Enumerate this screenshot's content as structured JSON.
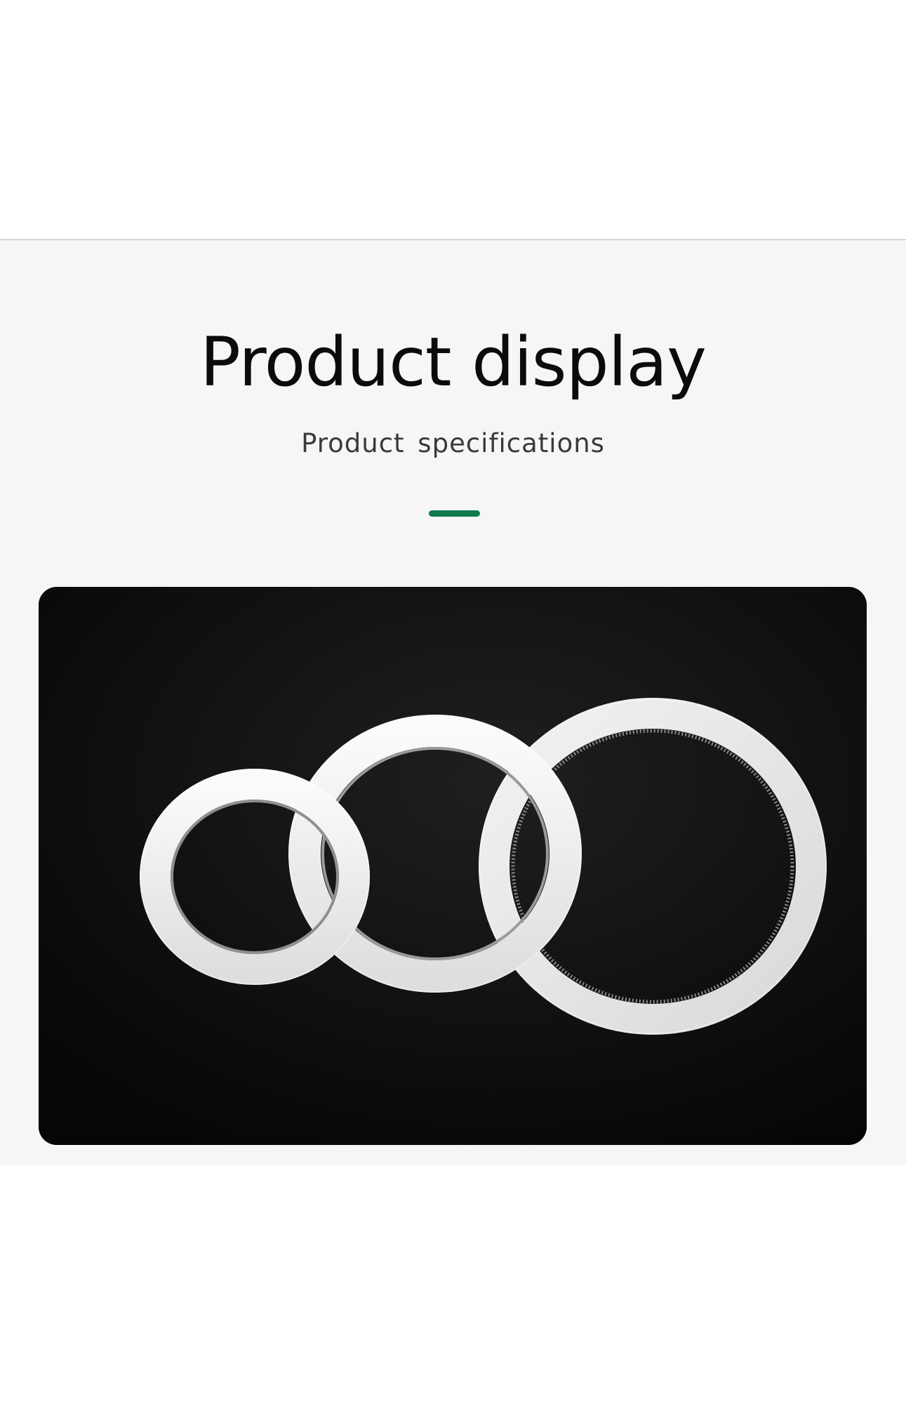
{
  "header": {
    "title": "Product display",
    "subtitle": "Product  specifications"
  },
  "colors": {
    "accent": "#0e7a4f",
    "section_background": "#f6f6f6",
    "photo_background": "#0e0e0e",
    "ring_color": "#f0f0f0"
  },
  "product_image": {
    "subject": "three white sealing rings on black surface"
  }
}
